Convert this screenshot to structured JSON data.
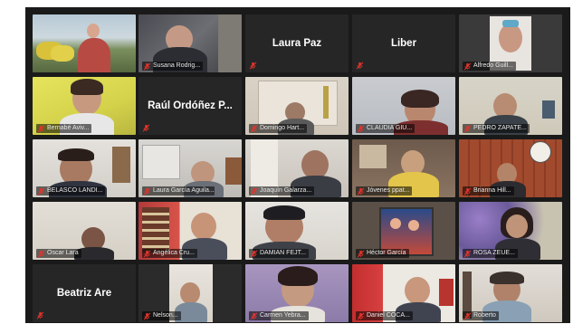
{
  "colors": {
    "background": "#1a1a1a",
    "tile": "#2b2b2b",
    "active_speaker_border": "#c6dc44",
    "muted_mic": "#e0342c",
    "label_text": "#e8e8e8"
  },
  "tiles": [
    {
      "id": "r1c1",
      "name": "",
      "big_name": "",
      "video": true,
      "muted": false
    },
    {
      "id": "r1c2",
      "name": "Susana Rodrig...",
      "big_name": "",
      "video": true,
      "muted": true
    },
    {
      "id": "r1c3",
      "name": "",
      "big_name": "Laura Paz",
      "video": false,
      "muted": true
    },
    {
      "id": "r1c4",
      "name": "",
      "big_name": "Liber",
      "video": false,
      "muted": true
    },
    {
      "id": "r1c5",
      "name": "Alfredo Guill...",
      "big_name": "",
      "video": true,
      "muted": true
    },
    {
      "id": "r2c1",
      "name": "Bernabé Aviv...",
      "big_name": "",
      "video": true,
      "muted": true
    },
    {
      "id": "r2c2",
      "name": "",
      "big_name": "Raúl Ordóñez P...",
      "video": false,
      "muted": true
    },
    {
      "id": "r2c3",
      "name": "Domingo Hart...",
      "big_name": "",
      "video": true,
      "muted": true
    },
    {
      "id": "r2c4",
      "name": "CLAUDIA GIU...",
      "big_name": "",
      "video": true,
      "muted": true
    },
    {
      "id": "r2c5",
      "name": "PEDRO ZAPATE...",
      "big_name": "",
      "video": true,
      "muted": true
    },
    {
      "id": "r3c1",
      "name": "BELASCO LANDI...",
      "big_name": "",
      "video": true,
      "muted": true
    },
    {
      "id": "r3c2",
      "name": "Laura García Aguila...",
      "big_name": "",
      "video": true,
      "muted": true
    },
    {
      "id": "r3c3",
      "name": "Joaquín Galarza...",
      "big_name": "",
      "video": true,
      "muted": true
    },
    {
      "id": "r3c4",
      "name": "Jóvenes ppat...",
      "big_name": "",
      "video": true,
      "muted": true
    },
    {
      "id": "r3c5",
      "name": "Brianna Hill...",
      "big_name": "",
      "video": true,
      "muted": true
    },
    {
      "id": "r4c1",
      "name": "Oscar Lara",
      "big_name": "",
      "video": true,
      "muted": true
    },
    {
      "id": "r4c2",
      "name": "Angélica Cru...",
      "big_name": "",
      "video": true,
      "muted": true
    },
    {
      "id": "r4c3",
      "name": "DAMIAN FEJT...",
      "big_name": "",
      "video": true,
      "muted": true
    },
    {
      "id": "r4c4",
      "name": "Héctor García",
      "big_name": "",
      "video": true,
      "muted": true
    },
    {
      "id": "r4c5",
      "name": "ROSA ZEUE...",
      "big_name": "",
      "video": true,
      "muted": true
    },
    {
      "id": "r5c1",
      "name": "",
      "big_name": "Beatriz Are",
      "video": false,
      "muted": true
    },
    {
      "id": "r5c2",
      "name": "Nelson...",
      "big_name": "",
      "video": true,
      "muted": true
    },
    {
      "id": "r5c3",
      "name": "Carmen Yebra...",
      "big_name": "",
      "video": true,
      "muted": true
    },
    {
      "id": "r5c4",
      "name": "Daniel COCA...",
      "big_name": "",
      "video": true,
      "muted": true
    },
    {
      "id": "r5c5",
      "name": "Roberto",
      "big_name": "",
      "video": true,
      "muted": true,
      "active": true
    }
  ]
}
